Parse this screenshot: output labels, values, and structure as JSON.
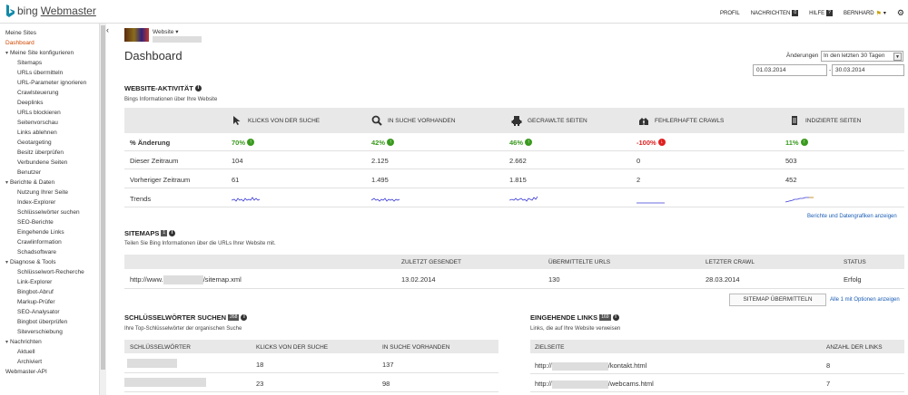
{
  "header": {
    "logo_word": "bing",
    "logo_product": "Webmaster",
    "nav": [
      {
        "label": "PROFIL"
      },
      {
        "label": "NACHRICHTEN",
        "count": "0"
      },
      {
        "label": "HILFE",
        "count": "?"
      },
      {
        "label": "BERNHARD"
      }
    ]
  },
  "sidebar": {
    "items": [
      {
        "label": "Meine Sites"
      },
      {
        "label": "Dashboard"
      },
      {
        "label": "Meine Site konfigurieren"
      },
      {
        "label": "Sitemaps"
      },
      {
        "label": "URLs übermitteln"
      },
      {
        "label": "URL-Parameter ignorieren"
      },
      {
        "label": "Crawlsteuerung"
      },
      {
        "label": "Deeplinks"
      },
      {
        "label": "URLs blockieren"
      },
      {
        "label": "Seitenvorschau"
      },
      {
        "label": "Links ablehnen"
      },
      {
        "label": "Geotargeting"
      },
      {
        "label": "Besitz überprüfen"
      },
      {
        "label": "Verbundene Seiten"
      },
      {
        "label": "Benutzer"
      },
      {
        "label": "Berichte & Daten"
      },
      {
        "label": "Nutzung Ihrer Seite"
      },
      {
        "label": "Index-Explorer"
      },
      {
        "label": "Schlüsselwörter suchen"
      },
      {
        "label": "SEO-Berichte"
      },
      {
        "label": "Eingehende Links"
      },
      {
        "label": "Crawlinformation"
      },
      {
        "label": "Schadsoftware"
      },
      {
        "label": "Diagnose & Tools"
      },
      {
        "label": "Schlüsselwort-Recherche"
      },
      {
        "label": "Link-Explorer"
      },
      {
        "label": "Bingbot-Abruf"
      },
      {
        "label": "Markup-Prüfer"
      },
      {
        "label": "SEO-Analysator"
      },
      {
        "label": "Bingbot überprüfen"
      },
      {
        "label": "Siteverschiebung"
      },
      {
        "label": "Nachrichten"
      },
      {
        "label": "Aktuell"
      },
      {
        "label": "Archiviert"
      },
      {
        "label": "Webmaster-API"
      }
    ]
  },
  "site": {
    "label": "Website"
  },
  "page": {
    "title": "Dashboard"
  },
  "filter": {
    "label": "Änderungen",
    "selected": "In den letzten 30 Tagen",
    "date_from": "01.03.2014",
    "date_sep": "-",
    "date_to": "30.03.2014"
  },
  "activity": {
    "title": "WEBSITE-AKTIVITÄT",
    "subtitle": "Bings Informationen über Ihre Website",
    "columns": [
      {
        "label": "KLICKS VON DER SUCHE",
        "icon": "cursor-icon"
      },
      {
        "label": "IN SUCHE VORHANDEN",
        "icon": "magnifier-icon"
      },
      {
        "label": "GECRAWLTE SEITEN",
        "icon": "robot-icon"
      },
      {
        "label": "FEHLERHAFTE CRAWLS",
        "icon": "broken-robot-icon"
      },
      {
        "label": "INDIZIERTE SEITEN",
        "icon": "document-icon"
      }
    ],
    "rows": {
      "change": {
        "label": "% Änderung",
        "values": [
          "70%",
          "42%",
          "46%",
          "-100%",
          "11%"
        ],
        "dirs": [
          "up",
          "up",
          "up",
          "down",
          "up"
        ]
      },
      "current": {
        "label": "Dieser Zeitraum",
        "values": [
          "104",
          "2.125",
          "2.662",
          "0",
          "503"
        ]
      },
      "previous": {
        "label": "Vorheriger Zeitraum",
        "values": [
          "61",
          "1.495",
          "1.815",
          "2",
          "452"
        ]
      },
      "trends": {
        "label": "Trends"
      }
    },
    "link": "Berichte und Datengrafiken anzeigen",
    "colors": {
      "up": "#3a9a1e",
      "down": "#e02020",
      "spark": "#3b3bd6"
    }
  },
  "sitemaps": {
    "title": "SITEMAPS",
    "badge": "1",
    "subtitle": "Teilen Sie Bing Informationen über die URLs Ihrer Website mit.",
    "headers": [
      "ZULETZT GESENDET",
      "ÜBERMITTELTE URLS",
      "LETZTER CRAWL",
      "STATUS"
    ],
    "row": {
      "url_prefix": "http://www.",
      "url_suffix": "/sitemap.xml",
      "sent": "13.02.2014",
      "urls": "130",
      "crawl": "28.03.2014",
      "status": "Erfolg"
    },
    "button": "SITEMAP ÜBERMITTELN",
    "options_link": "Alle 1 mit Optionen anzeigen"
  },
  "keywords": {
    "title": "SCHLÜSSELWÖRTER SUCHEN",
    "badge": "268",
    "subtitle": "Ihre Top-Schlüsselwörter der organischen Suche",
    "headers": [
      "SCHLÜSSELWÖRTER",
      "KLICKS VON DER SUCHE",
      "IN SUCHE VORHANDEN"
    ],
    "rows": [
      {
        "clicks": "18",
        "present": "137"
      },
      {
        "clicks": "23",
        "present": "98"
      }
    ]
  },
  "inbound": {
    "title": "EINGEHENDE LINKS",
    "badge": "169",
    "subtitle": "Links, die auf Ihre Website verweisen",
    "headers": [
      "ZIELSEITE",
      "ANZAHL DER LINKS"
    ],
    "rows": [
      {
        "prefix": "http://",
        "suffix": "/kontakt.html",
        "count": "8"
      },
      {
        "prefix": "http://",
        "suffix": "/webcams.html",
        "count": "7"
      }
    ]
  }
}
